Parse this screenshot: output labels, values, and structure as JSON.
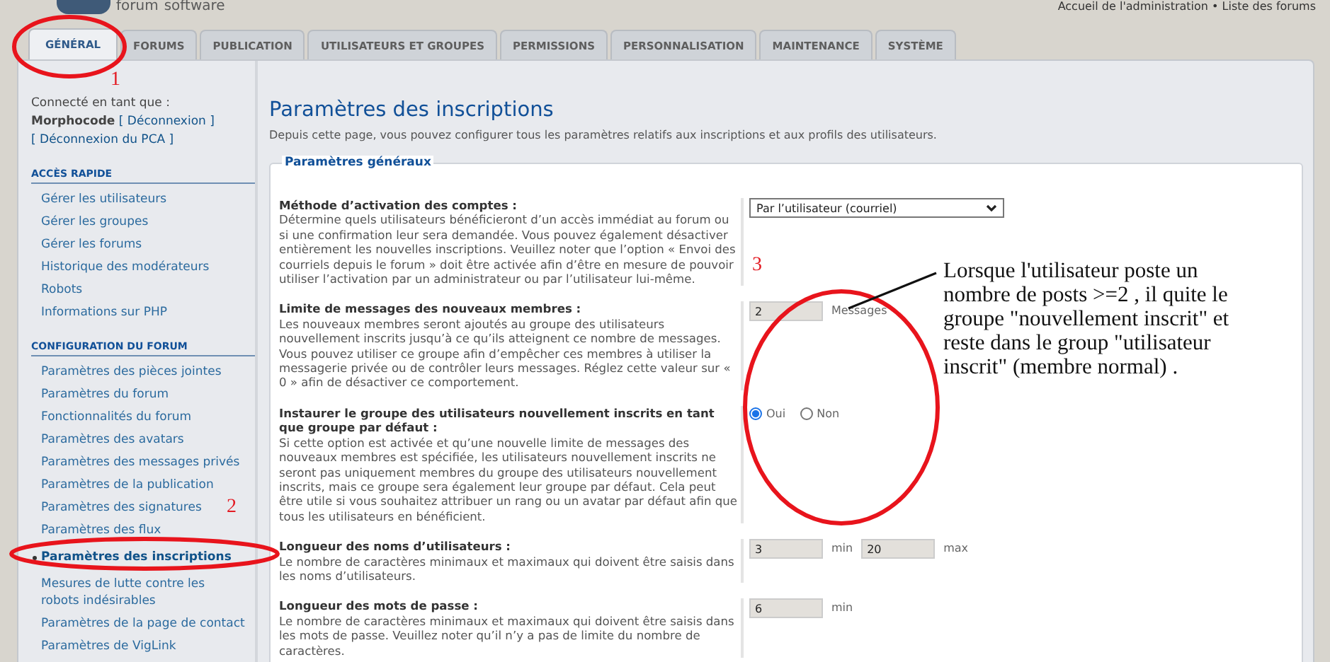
{
  "header": {
    "logo": {
      "line1": "forum",
      "line2": "software"
    },
    "breadcrumb": "Accueil de l'administration • Liste des forums"
  },
  "tabs": [
    {
      "label": "GÉNÉRAL",
      "selected": true
    },
    {
      "label": "FORUMS",
      "selected": false
    },
    {
      "label": "PUBLICATION",
      "selected": false
    },
    {
      "label": "UTILISATEURS ET GROUPES",
      "selected": false
    },
    {
      "label": "PERMISSIONS",
      "selected": false
    },
    {
      "label": "PERSONNALISATION",
      "selected": false
    },
    {
      "label": "MAINTENANCE",
      "selected": false
    },
    {
      "label": "SYSTÈME",
      "selected": false
    }
  ],
  "sidebar": {
    "login": {
      "label": "Connecté en tant que :",
      "user": "Morphocode",
      "logout": "[ Déconnexion ]",
      "acp_logout": "[ Déconnexion du PCA ]"
    },
    "sections": [
      {
        "title": "ACCÈS RAPIDE",
        "items": [
          {
            "label": "Gérer les utilisateurs",
            "selected": false
          },
          {
            "label": "Gérer les groupes",
            "selected": false
          },
          {
            "label": "Gérer les forums",
            "selected": false
          },
          {
            "label": "Historique des modérateurs",
            "selected": false
          },
          {
            "label": "Robots",
            "selected": false
          },
          {
            "label": "Informations sur PHP",
            "selected": false
          }
        ]
      },
      {
        "title": "CONFIGURATION DU FORUM",
        "items": [
          {
            "label": "Paramètres des pièces jointes",
            "selected": false
          },
          {
            "label": "Paramètres du forum",
            "selected": false
          },
          {
            "label": "Fonctionnalités du forum",
            "selected": false
          },
          {
            "label": "Paramètres des avatars",
            "selected": false
          },
          {
            "label": "Paramètres des messages privés",
            "selected": false
          },
          {
            "label": "Paramètres de la publication",
            "selected": false
          },
          {
            "label": "Paramètres des signatures",
            "selected": false
          },
          {
            "label": "Paramètres des flux",
            "selected": false
          },
          {
            "label": "Paramètres des inscriptions",
            "selected": true
          },
          {
            "label": "Mesures de lutte contre les robots indésirables",
            "selected": false
          },
          {
            "label": "Paramètres de la page de contact",
            "selected": false
          },
          {
            "label": "Paramètres de VigLink",
            "selected": false
          }
        ]
      }
    ]
  },
  "content": {
    "title": "Paramètres des inscriptions",
    "intro": "Depuis cette page, vous pouvez configurer tous les paramètres relatifs aux inscriptions et aux profils des utilisateurs.",
    "fieldset": {
      "legend": "Paramètres généraux",
      "rows": [
        {
          "kind": "select",
          "title": "Méthode d’activation des comptes :",
          "description": "Détermine quels utilisateurs bénéficieront d’un accès immédiat au forum ou si une confirmation leur sera demandée. Vous pouvez également désactiver entièrement les nouvelles inscriptions. Veuillez noter que l’option « Envoi des courriels depuis le forum » doit être activée afin d’être en mesure de pouvoir utiliser l’activation par un administrateur ou par l’utilisateur lui-même.",
          "value": "Par l’utilisateur (courriel)"
        },
        {
          "kind": "number",
          "title": "Limite de messages des nouveaux membres :",
          "description": "Les nouveaux membres seront ajoutés au groupe des utilisateurs nouvellement inscrits jusqu’à ce qu’ils atteignent ce nombre de messages. Vous pouvez utiliser ce groupe afin d’empêcher ces membres à utiliser la messagerie privée ou de contrôler leurs messages. Réglez cette valeur sur « 0 » afin de désactiver ce comportement.",
          "inputs": [
            {
              "value": "2",
              "unit": "Messages"
            }
          ]
        },
        {
          "kind": "radio",
          "title": "Instaurer le groupe des utilisateurs nouvellement inscrits en tant que groupe par défaut :",
          "description": "Si cette option est activée et qu’une nouvelle limite de messages des nouveaux membres est spécifiée, les utilisateurs nouvellement inscrits ne seront pas uniquement membres du groupe des utilisateurs nouvellement inscrits, mais ce groupe sera également leur groupe par défaut. Cela peut être utile si vous souhaitez attribuer un rang ou un avatar par défaut afin que tous les utilisateurs en bénéficient.",
          "options": [
            {
              "label": "Oui",
              "selected": true
            },
            {
              "label": "Non",
              "selected": false
            }
          ]
        },
        {
          "kind": "number",
          "title": "Longueur des noms d’utilisateurs :",
          "description": "Le nombre de caractères minimaux et maximaux qui doivent être saisis dans les noms d’utilisateurs.",
          "inputs": [
            {
              "value": "3",
              "unit": "min"
            },
            {
              "value": "20",
              "unit": "max"
            }
          ]
        },
        {
          "kind": "number",
          "title": "Longueur des mots de passe :",
          "description": "Le nombre de caractères minimaux et maximaux qui doivent être saisis dans les mots de passe. Veuillez noter qu’il n’y a pas de limite du nombre de caractères.",
          "inputs": [
            {
              "value": "6",
              "unit": "min"
            }
          ]
        }
      ]
    }
  },
  "annotations": [
    {
      "kind": "ellipse"
    },
    {
      "kind": "number",
      "text": "1"
    },
    {
      "kind": "ellipse"
    },
    {
      "kind": "number",
      "text": "2"
    },
    {
      "kind": "ellipse"
    },
    {
      "kind": "number",
      "text": "3"
    },
    {
      "kind": "leader"
    },
    {
      "kind": "callout",
      "text": "Lorsque l'utilisateur poste un nombre de posts >=2 , il quite le groupe \"nouvellement inscrit\" et reste dans le group \"utilisateur inscrit\" (membre normal) ."
    }
  ]
}
